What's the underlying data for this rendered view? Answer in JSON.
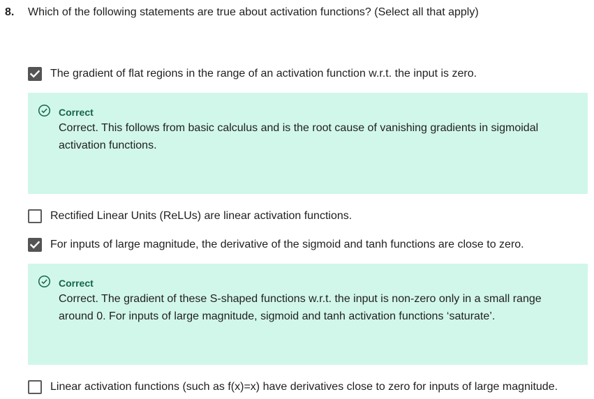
{
  "question": {
    "number": "8.",
    "prompt": "Which of the following statements are true about activation functions? (Select all that apply)"
  },
  "options": [
    {
      "label": "The gradient of flat regions in the range of an activation function w.r.t. the input is zero.",
      "checked": true,
      "feedback": {
        "status": "Correct",
        "text": "Correct. This follows from basic calculus and is the root cause of vanishing gradients in sigmoidal activation functions."
      }
    },
    {
      "label": "Rectified Linear Units (ReLUs) are linear activation functions.",
      "checked": false
    },
    {
      "label": "For inputs of large magnitude, the derivative of the sigmoid and tanh functions are close to zero.",
      "checked": true,
      "feedback": {
        "status": "Correct",
        "text": "Correct. The gradient of these S-shaped functions w.r.t. the input is non-zero only in a small range around 0. For inputs of large magnitude, sigmoid and tanh activation functions ‘saturate’."
      }
    },
    {
      "label": "Linear activation functions (such as f(x)=x) have derivatives close to zero for inputs of large magnitude.",
      "checked": false
    }
  ],
  "colors": {
    "feedback_bg": "#d1f7ea",
    "correct_green": "#16654a",
    "checkbox_checked": "#545454"
  }
}
